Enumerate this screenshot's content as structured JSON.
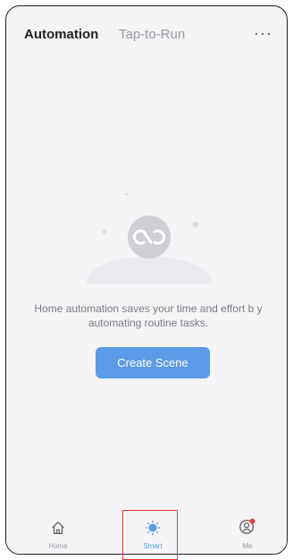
{
  "header": {
    "tabs": [
      {
        "label": "Automation",
        "active": true
      },
      {
        "label": "Tap-to-Run",
        "active": false
      }
    ],
    "more_icon": "more-dots-icon"
  },
  "empty_state": {
    "message": "Home automation saves your time and effort b y automating routine tasks.",
    "icon": "loop-icon"
  },
  "create_button": {
    "label": "Create Scene"
  },
  "bottom_nav": {
    "items": [
      {
        "label": "Home",
        "icon": "home-icon",
        "active": false
      },
      {
        "label": "Smart",
        "icon": "sun-icon",
        "active": true
      },
      {
        "label": "Me",
        "icon": "user-icon",
        "active": false,
        "badge": true
      }
    ]
  },
  "colors": {
    "accent": "#5b9ae6",
    "background": "#f4f4f6",
    "highlight_box": "#e53935",
    "badge": "#e53935"
  }
}
